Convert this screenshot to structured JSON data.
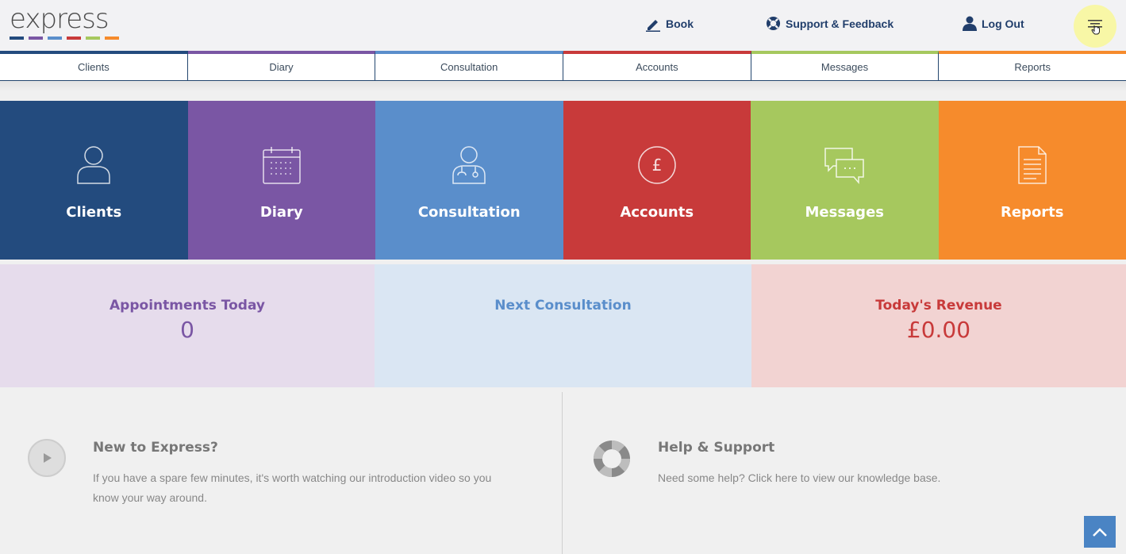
{
  "header": {
    "logo_text": "express",
    "links": {
      "book": "Book",
      "support": "Support & Feedback",
      "logout": "Log Out"
    }
  },
  "colors": {
    "clients": "#234b7e",
    "diary": "#7a56a4",
    "consultation": "#5a8ecb",
    "accounts": "#c83a3a",
    "messages": "#a6c85e",
    "reports": "#f68b2c"
  },
  "nav": {
    "tabs": [
      {
        "label": "Clients"
      },
      {
        "label": "Diary"
      },
      {
        "label": "Consultation"
      },
      {
        "label": "Accounts"
      },
      {
        "label": "Messages"
      },
      {
        "label": "Reports"
      }
    ]
  },
  "tiles": [
    {
      "label": "Clients",
      "icon": "user-icon"
    },
    {
      "label": "Diary",
      "icon": "calendar-icon"
    },
    {
      "label": "Consultation",
      "icon": "doctor-icon"
    },
    {
      "label": "Accounts",
      "icon": "pound-icon"
    },
    {
      "label": "Messages",
      "icon": "chat-icon"
    },
    {
      "label": "Reports",
      "icon": "document-icon"
    }
  ],
  "stats": {
    "appointments": {
      "title": "Appointments Today",
      "value": "0"
    },
    "next_consultation": {
      "title": "Next Consultation",
      "value": ""
    },
    "revenue": {
      "title": "Today's Revenue",
      "value": "£0.00"
    }
  },
  "info": {
    "intro": {
      "title": "New to Express?",
      "text": "If you have a spare few minutes, it's worth watching our introduction video so you know your way around."
    },
    "help": {
      "title": "Help & Support",
      "text": "Need some help? Click here to view our knowledge base."
    }
  }
}
